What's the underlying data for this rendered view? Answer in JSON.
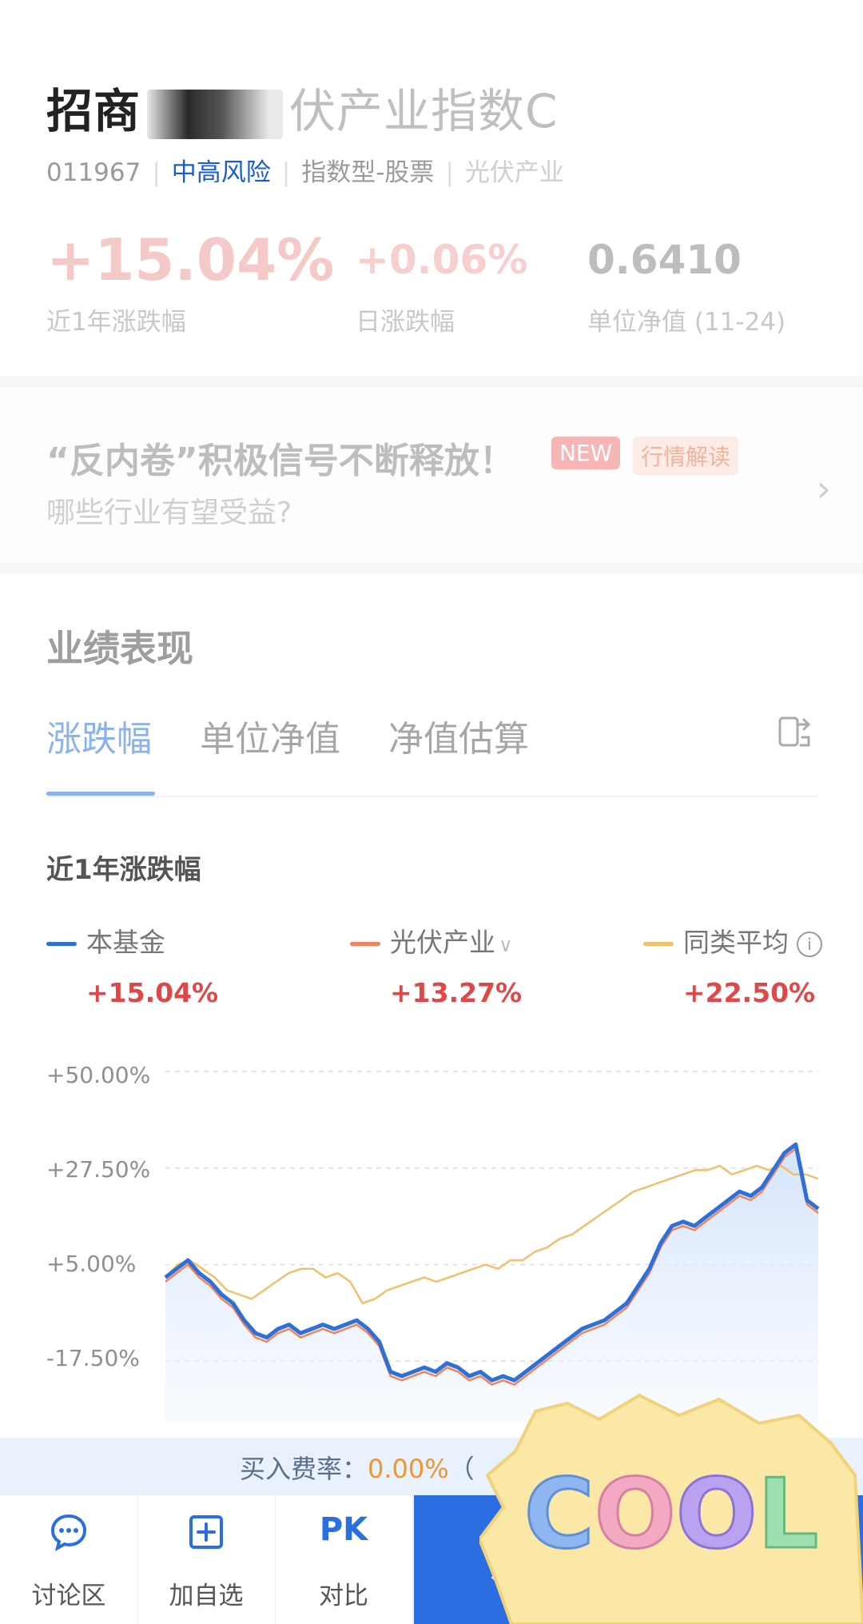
{
  "fund": {
    "title_prefix": "招商",
    "title_suffix": "伏产业指数C",
    "code": "011967",
    "risk": "中高风险",
    "type": "指数型-股票",
    "sector": "光伏产业"
  },
  "stats": {
    "year_change": "+15.04%",
    "year_change_label": "近1年涨跌幅",
    "day_change": "+0.06%",
    "day_change_label": "日涨跌幅",
    "nav": "0.6410",
    "nav_label": "单位净值 (11-24)"
  },
  "news": {
    "line1": "“反内卷”积极信号不断释放！",
    "line2": "哪些行业有望受益?",
    "tag_new": "NEW",
    "tag_market": "行情解读"
  },
  "performance": {
    "section_title": "业绩表现",
    "tabs": [
      "涨跌幅",
      "单位净值",
      "净值估算"
    ],
    "subtitle": "近1年涨跌幅",
    "legend": [
      {
        "name": "本基金",
        "value": "+15.04%",
        "color": "#2f6fd8"
      },
      {
        "name": "光伏产业",
        "value": "+13.27%",
        "color": "#f0845a"
      },
      {
        "name": "同类平均",
        "value": "+22.50%",
        "color": "#f2c06a"
      }
    ]
  },
  "chart_data": {
    "type": "line",
    "y_ticks": [
      "+50.00%",
      "+27.50%",
      "+5.00%",
      "-17.50%"
    ],
    "ylim": [
      -32,
      50
    ],
    "series": [
      {
        "name": "本基金",
        "color": "#2f6fd8",
        "values": [
          2,
          4,
          6,
          3,
          1,
          -2,
          -4,
          -8,
          -11,
          -12,
          -10,
          -9,
          -11,
          -10,
          -9,
          -10,
          -9,
          -8,
          -10,
          -13,
          -20,
          -21,
          -20,
          -19,
          -20,
          -18,
          -19,
          -21,
          -20,
          -22,
          -21,
          -22,
          -20,
          -18,
          -16,
          -14,
          -12,
          -10,
          -9,
          -8,
          -6,
          -4,
          0,
          4,
          10,
          14,
          15,
          14,
          16,
          18,
          20,
          22,
          21,
          23,
          27,
          31,
          33,
          20,
          18
        ]
      },
      {
        "name": "光伏产业",
        "color": "#f0845a",
        "values": [
          1,
          3,
          5,
          2,
          0,
          -3,
          -5,
          -9,
          -12,
          -13,
          -11,
          -10,
          -12,
          -11,
          -10,
          -11,
          -10,
          -9,
          -11,
          -14,
          -21,
          -22,
          -21,
          -20,
          -21,
          -19,
          -20,
          -22,
          -21,
          -23,
          -22,
          -23,
          -21,
          -19,
          -17,
          -15,
          -13,
          -11,
          -10,
          -9,
          -7,
          -5,
          -1,
          3,
          9,
          13,
          14,
          13,
          15,
          17,
          19,
          21,
          20,
          22,
          26,
          30,
          32,
          19,
          17
        ]
      },
      {
        "name": "同类平均",
        "color": "#f2c06a",
        "values": [
          2,
          5,
          6,
          4,
          2,
          -1,
          -2,
          -3,
          -1,
          1,
          3,
          4,
          4,
          2,
          3,
          1,
          -4,
          -3,
          -1,
          0,
          1,
          2,
          1,
          2,
          3,
          4,
          5,
          4,
          6,
          6,
          8,
          9,
          11,
          12,
          14,
          16,
          18,
          20,
          22,
          23,
          24,
          25,
          26,
          27,
          27,
          28,
          26,
          27,
          28,
          27,
          28,
          26,
          26,
          25
        ]
      }
    ]
  },
  "fee": {
    "label": "买入费率：",
    "rate": "0.00%",
    "suffix": "（"
  },
  "bottom_bar": {
    "discuss": "讨论区",
    "watchlist": "加自选",
    "compare": "对比",
    "compare_icon_text": "PK",
    "primary": "定投"
  },
  "sticker": {
    "text": "COOL"
  }
}
